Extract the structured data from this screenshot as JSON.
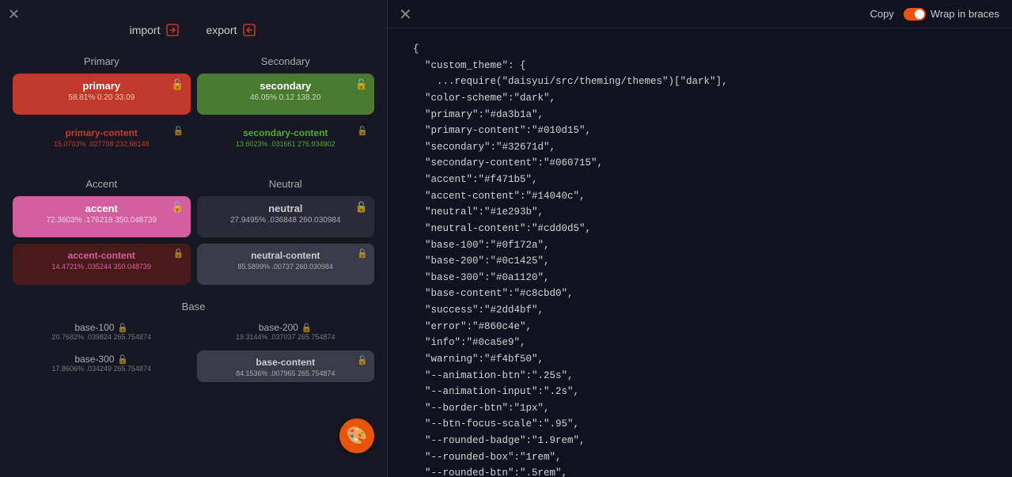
{
  "left_panel": {
    "close_label": "✕",
    "import_label": "import",
    "export_label": "export",
    "sections": {
      "primary": {
        "label": "Primary",
        "main": {
          "name": "primary",
          "value": "58.81% 0.20 33.09",
          "bg": "#c0392b"
        },
        "content": {
          "name": "primary-content",
          "value": "15.0703% .027798 232.66148"
        }
      },
      "secondary": {
        "label": "Secondary",
        "main": {
          "name": "secondary",
          "value": "46.05% 0.12 138.20",
          "bg": "#4a7a30"
        },
        "content": {
          "name": "secondary-content",
          "value": "13.6023% .031661 276.934902"
        }
      },
      "accent": {
        "label": "Accent",
        "main": {
          "name": "accent",
          "value": "72.3603% .176218 350.048739",
          "bg": "#d45fa0"
        },
        "content": {
          "name": "accent-content",
          "value": "14.4721% .035244 350.048739"
        }
      },
      "neutral": {
        "label": "Neutral",
        "main": {
          "name": "neutral",
          "value": "27.9495% .036848 260.030984"
        },
        "content": {
          "name": "neutral-content",
          "value": "85.5899% .00737 260.030984"
        }
      },
      "base": {
        "label": "Base",
        "items": [
          {
            "name": "base-100",
            "value": "20.7682% .039824 265.754874"
          },
          {
            "name": "base-200",
            "value": "19.3144% .037037 265.754874"
          },
          {
            "name": "base-300",
            "value": "17.8606% .034249 265.754874"
          },
          {
            "name": "base-content",
            "value": "84.1536% .007965 265.754874"
          }
        ]
      }
    },
    "palette_icon": "🎨"
  },
  "right_panel": {
    "close_label": "✕",
    "copy_label": "Copy",
    "wrap_label": "Wrap in braces",
    "wrap_enabled": true,
    "code": "{\n  \"custom_theme\": {\n    ...require(\"daisyui/src/theming/themes\")[\"dark\"],\n  \"color-scheme\":\"dark\",\n  \"primary\":\"#da3b1a\",\n  \"primary-content\":\"#010d15\",\n  \"secondary\":\"#32671d\",\n  \"secondary-content\":\"#060715\",\n  \"accent\":\"#f471b5\",\n  \"accent-content\":\"#14040c\",\n  \"neutral\":\"#1e293b\",\n  \"neutral-content\":\"#cdd0d5\",\n  \"base-100\":\"#0f172a\",\n  \"base-200\":\"#0c1425\",\n  \"base-300\":\"#0a1120\",\n  \"base-content\":\"#c8cbd0\",\n  \"success\":\"#2dd4bf\",\n  \"error\":\"#860c4e\",\n  \"info\":\"#0ca5e9\",\n  \"warning\":\"#f4bf50\",\n  \"--animation-btn\":\".25s\",\n  \"--animation-input\":\".2s\",\n  \"--border-btn\":\"1px\",\n  \"--btn-focus-scale\":\".95\",\n  \"--rounded-badge\":\"1.9rem\",\n  \"--rounded-box\":\"1rem\",\n  \"--rounded-btn\":\".5rem\","
  }
}
